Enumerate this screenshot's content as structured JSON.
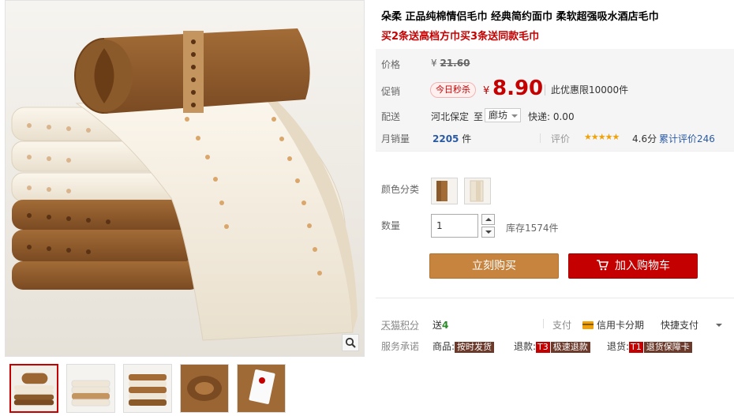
{
  "product": {
    "title": "朵柔 正品纯棉情侣毛巾 经典简约面巾 柔软超强吸水酒店毛巾",
    "subtitle": "买2条送高档方巾买3条送同款毛巾"
  },
  "price": {
    "label": "价格",
    "currency": "¥",
    "original": "21.60",
    "promo_label": "促销",
    "promo_tag": "今日秒杀",
    "promo_price": "8.90",
    "limit_note": "此优惠限10000件"
  },
  "delivery": {
    "label": "配送",
    "from": "河北保定",
    "to_word": "至",
    "to_city": "廊坊",
    "shipping": "快递: 0.00"
  },
  "sales": {
    "label": "月销量",
    "count": "2205",
    "unit": "件",
    "rating_label": "评价",
    "stars": "★★★★★",
    "rating_score": 4.6,
    "rating_text": "4.6分",
    "reviews_text": "累计评价246"
  },
  "color": {
    "label": "颜色分类",
    "options": [
      {
        "name": "brown-towel",
        "color": "#8b5a2b"
      },
      {
        "name": "cream-towel",
        "color": "#efe8dc"
      }
    ]
  },
  "quantity": {
    "label": "数量",
    "value": "1",
    "stock": "库存1574件"
  },
  "buttons": {
    "buy_now": "立刻购买",
    "add_cart": "加入购物车"
  },
  "services": {
    "points_label": "天猫积分",
    "points_prefix": "送",
    "points_value": "4",
    "pay_label": "支付",
    "credit_card": "信用卡分期",
    "quick_pay": "快捷支付",
    "promise_label": "服务承诺",
    "goods_label": "商品:",
    "goods_badge": "按时发货",
    "refund_label": "退款:",
    "refund_code": "T3",
    "refund_badge": "极速退款",
    "return_label": "退货:",
    "return_code": "T1",
    "return_badge": "退货保障卡"
  },
  "colors": {
    "accent": "#c40000",
    "buy_button": "#c7843f",
    "star": "#f0a20a",
    "brown_towel": "#8b5a2b",
    "cream_towel": "#f4ecdd"
  },
  "gallery": {
    "thumbnails": [
      "thumb-towel-stack-roll",
      "thumb-cream-stack",
      "thumb-brown-cream-stack",
      "thumb-brown-closeup",
      "thumb-label-tag"
    ],
    "zoom_icon": "magnifier-icon"
  }
}
